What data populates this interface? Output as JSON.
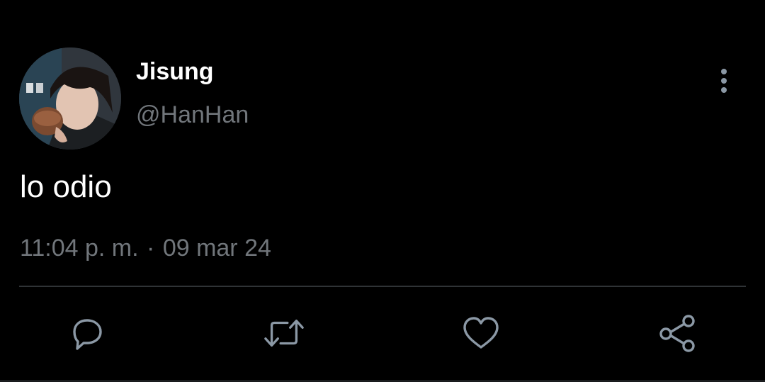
{
  "user": {
    "display_name": "Jisung",
    "handle": "@HanHan"
  },
  "tweet": {
    "text": "lo odio",
    "time": "11:04 p. m.",
    "separator": "·",
    "date": "09 mar 24"
  },
  "icons": {
    "more": "more-vertical-icon",
    "reply": "reply-icon",
    "retweet": "retweet-icon",
    "like": "heart-icon",
    "share": "share-icon"
  },
  "colors": {
    "background": "#000000",
    "primary_text": "#ffffff",
    "secondary_text": "#71767b",
    "divider": "#2f3336",
    "icon": "#8b98a5"
  }
}
